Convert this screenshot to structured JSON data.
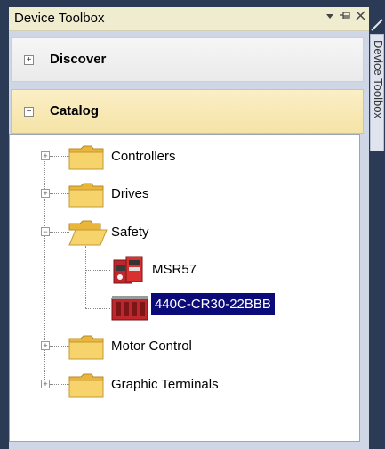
{
  "window": {
    "title": "Device Toolbox",
    "dropdown_icon": "chevron-down-icon",
    "pin_icon": "pin-icon",
    "close_icon": "close-icon"
  },
  "sections": {
    "discover": {
      "label": "Discover",
      "state": "collapsed"
    },
    "catalog": {
      "label": "Catalog",
      "state": "expanded"
    }
  },
  "tree": {
    "controllers": {
      "label": "Controllers",
      "icon": "folder-icon",
      "state": "collapsed"
    },
    "drives": {
      "label": "Drives",
      "icon": "folder-icon",
      "state": "collapsed"
    },
    "safety": {
      "label": "Safety",
      "icon": "open-folder-icon",
      "state": "expanded",
      "children": [
        {
          "label": "MSR57",
          "icon": "safety-relay-device-icon"
        },
        {
          "label": "440C-CR30-22BBB",
          "icon": "safety-controller-device-icon",
          "selected": true
        }
      ]
    },
    "motor_control": {
      "label": "Motor Control",
      "icon": "folder-icon",
      "state": "collapsed"
    },
    "graphic_terminals": {
      "label": "Graphic Terminals",
      "icon": "folder-icon",
      "state": "collapsed"
    }
  },
  "side_tab": {
    "label": "Device Toolbox"
  },
  "colors": {
    "selection": "#0a0a78",
    "catalog_header": "#f5e3a6",
    "title_bar": "#f0ecd0",
    "folder": "#f2c94c"
  }
}
